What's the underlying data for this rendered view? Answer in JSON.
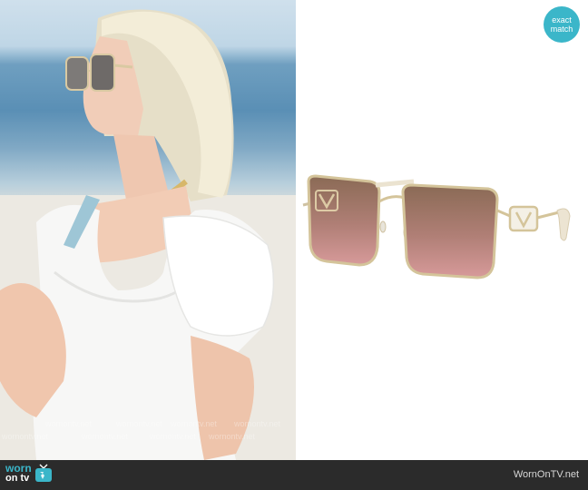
{
  "badge": {
    "line1": "exact",
    "line2": "match"
  },
  "footer": {
    "logo_worn": "worn",
    "logo_on": "on tv",
    "site_url": "WornOnTV.net"
  },
  "watermark": "wornontv.net",
  "colors": {
    "brand_teal": "#3bb6c9",
    "footer_bg": "#2b2b2b",
    "lens_top": "#8a6a55",
    "lens_bottom": "#c98f8f"
  }
}
